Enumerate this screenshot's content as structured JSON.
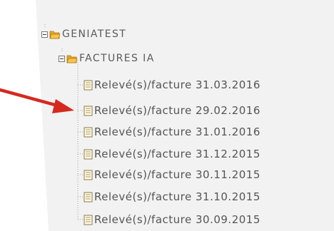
{
  "colors": {
    "panel_background": "#f2f2f2",
    "text": "#555555",
    "folder_icon": "#e8a32a",
    "arrow": "#d42a1f",
    "tree_line": "#a0a0a0"
  },
  "tree": {
    "root": {
      "label": "GENIATEST",
      "expanded": true,
      "icon": "folder-open-icon",
      "children": [
        {
          "label": "FACTURES IA",
          "expanded": true,
          "icon": "folder-open-icon",
          "items": [
            {
              "label": "Relevé(s)/facture 31.03.2016",
              "icon": "document-icon"
            },
            {
              "label": "Relevé(s)/facture 29.02.2016",
              "icon": "document-icon"
            },
            {
              "label": "Relevé(s)/facture 31.01.2016",
              "icon": "document-icon"
            },
            {
              "label": "Relevé(s)/facture 31.12.2015",
              "icon": "document-icon"
            },
            {
              "label": "Relevé(s)/facture 30.11.2015",
              "icon": "document-icon"
            },
            {
              "label": "Relevé(s)/facture 31.10.2015",
              "icon": "document-icon"
            },
            {
              "label": "Relevé(s)/facture 30.09.2015",
              "icon": "document-icon"
            }
          ]
        }
      ]
    }
  },
  "annotation": {
    "arrow_icon": "red-arrow-icon",
    "points_to_item": 1
  }
}
